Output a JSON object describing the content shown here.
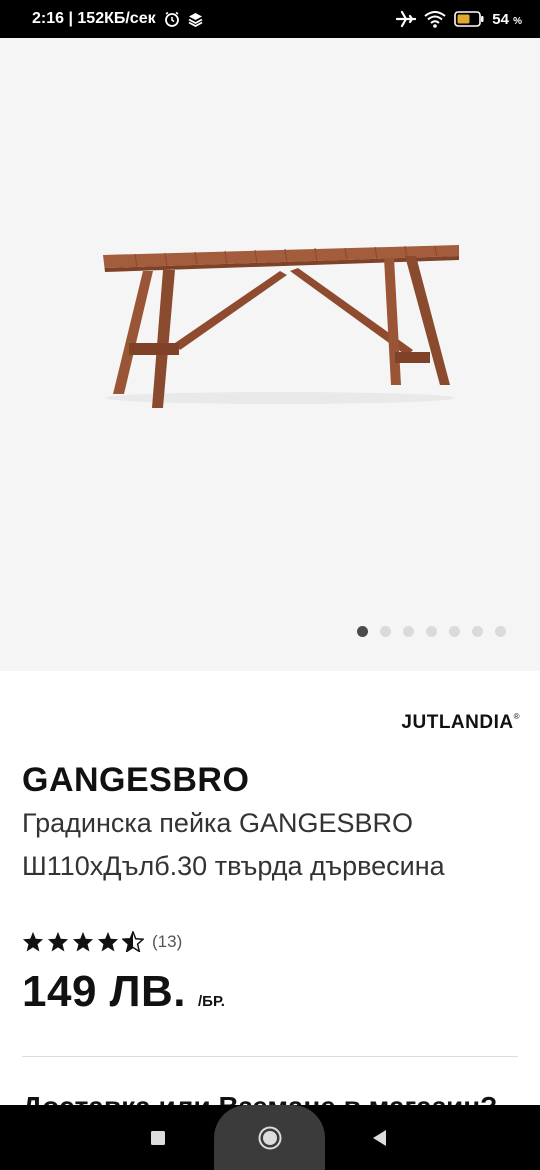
{
  "status_bar": {
    "time_speed": "2:16 | 152КБ/сек",
    "battery_level": "54",
    "battery_unit": "%",
    "icons": [
      "alarm-icon",
      "layers-icon",
      "airplane-icon",
      "wifi-icon",
      "battery-icon"
    ]
  },
  "gallery": {
    "image_alt": "bench-photo",
    "slide_count": 7,
    "active_slide": 1
  },
  "product": {
    "brand": "JUTLANDIA",
    "brand_mark": "®",
    "name": "GANGESBRO",
    "description": "Градинска пейка GANGESBRO Ш110хДълб.30 твърда дървесина",
    "rating": 4.5,
    "rating_count": "(13)",
    "price": "149 ЛВ.",
    "price_unit": "/БР.",
    "delivery_heading": "Доставка или Вземане в магазин?"
  },
  "colors": {
    "status_bar_bg": "#000000",
    "gallery_bg": "#f5f5f5",
    "text_primary": "#111111",
    "wood": "#a0583a"
  }
}
